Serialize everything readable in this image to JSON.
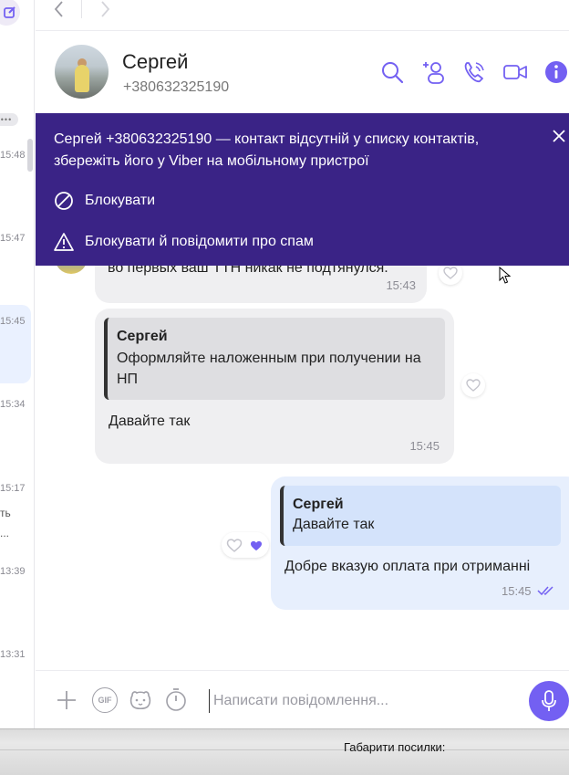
{
  "colors": {
    "accent": "#7360f2",
    "banner_bg": "#3a2386",
    "bubble_in": "#efeff1",
    "bubble_out": "#e7effd"
  },
  "left_strip": {
    "times": [
      "15:48",
      "15:47",
      "15:45",
      "15:34",
      "15:17",
      "13:39",
      "13:31"
    ],
    "snippet_1": "ть",
    "snippet_2": "..."
  },
  "header": {
    "name": "Сергей",
    "phone": "+380632325190",
    "icons": [
      "search-icon",
      "add-participant-icon",
      "call-icon",
      "video-call-icon",
      "info-icon"
    ]
  },
  "banner": {
    "text": "Сергей +380632325190 — контакт відсутній у списку контактів, збережіть його у Viber на мобільному пристрої",
    "block_label": "Блокувати",
    "block_spam_label": "Блокувати й повідомити про спам"
  },
  "messages": [
    {
      "direction": "in",
      "text": "во первых ваш ТТН никак не подтянулся.",
      "time": "15:43"
    },
    {
      "direction": "in",
      "quote_name": "Сергей",
      "quote_text": "Оформляйте наложенным при получении на НП",
      "text": "Давайте так",
      "time": "15:45"
    },
    {
      "direction": "out",
      "quote_name": "Сергей",
      "quote_text": "Давайте так",
      "text": "Добре вказую оплата при отриманні",
      "time": "15:45",
      "status": "read"
    }
  ],
  "composer": {
    "placeholder": "Написати повідомлення...",
    "gif_label": "GIF"
  },
  "bottom_window": {
    "text": "Габарити посилки:"
  }
}
